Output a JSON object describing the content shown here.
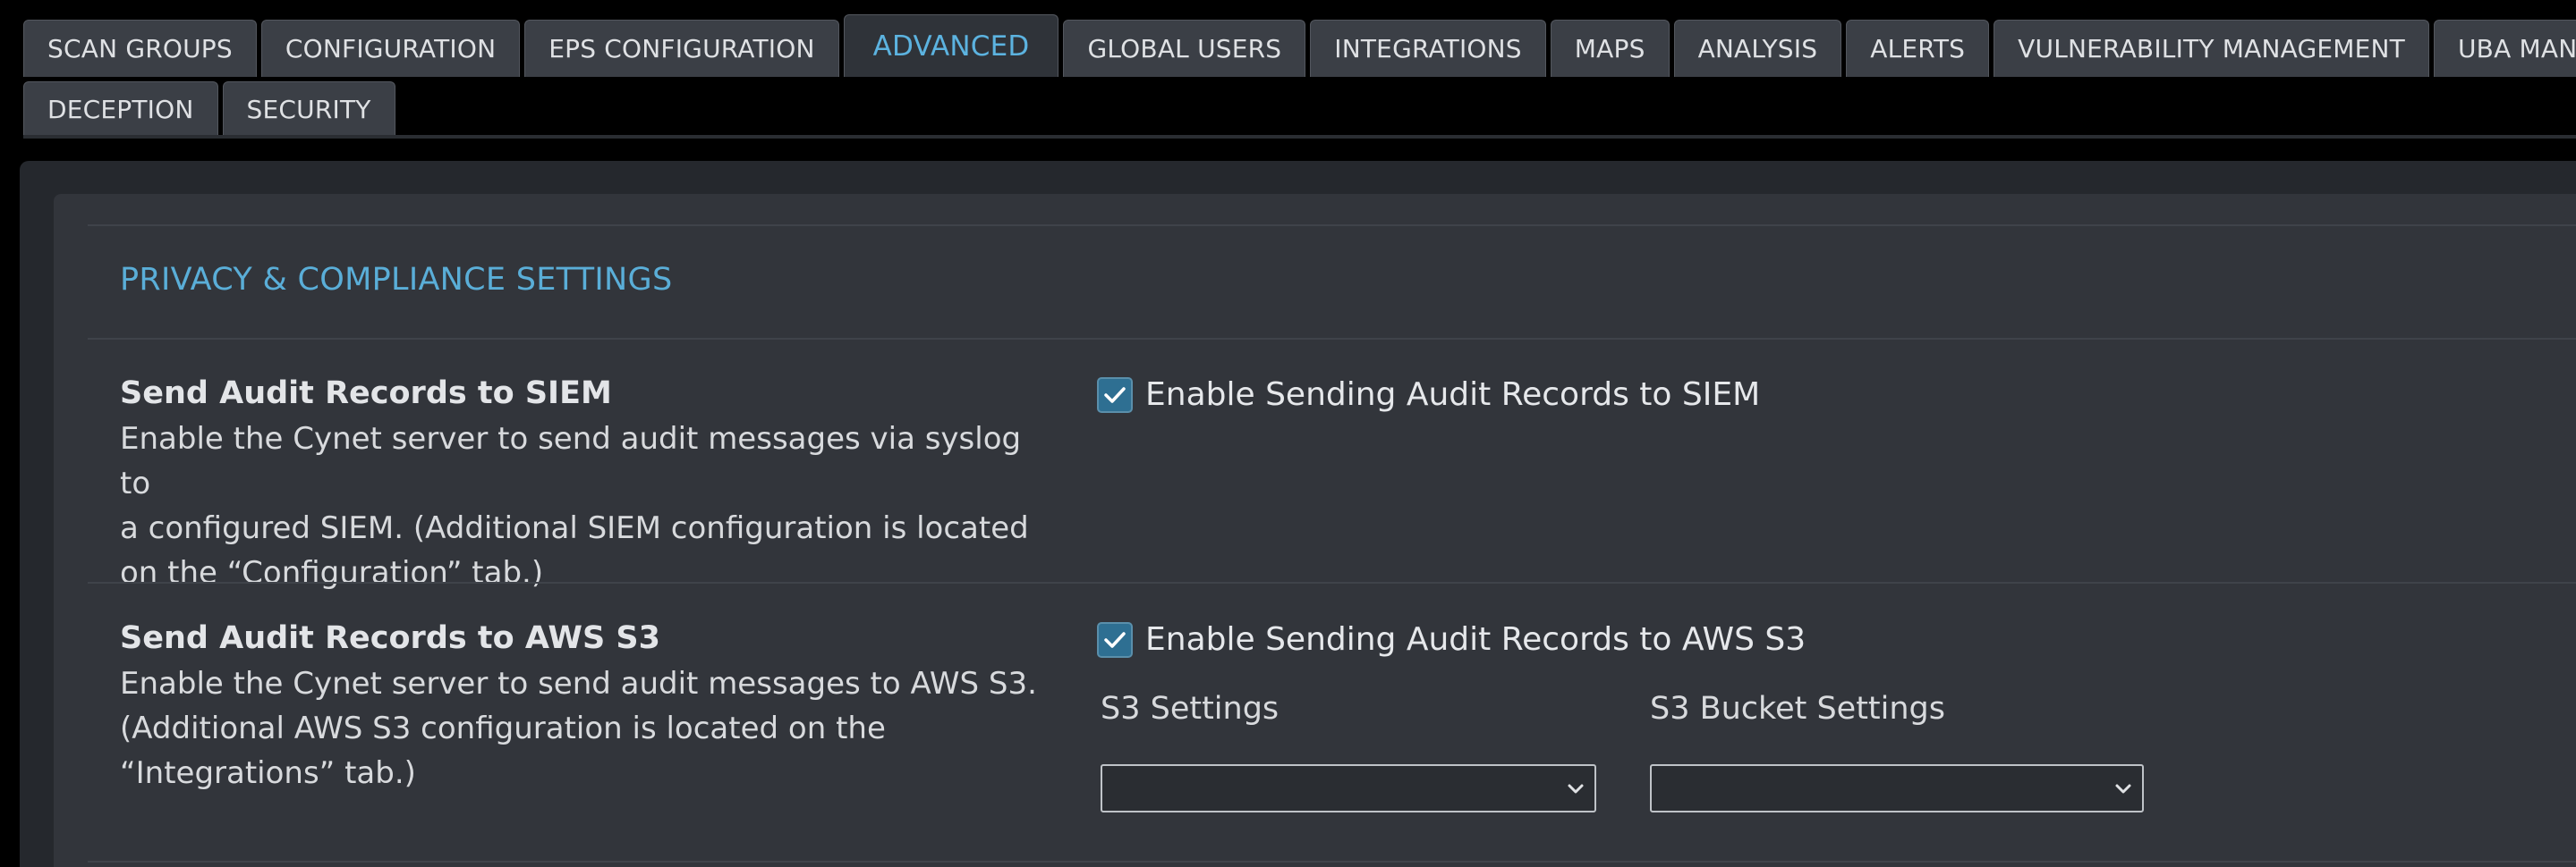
{
  "tabs_row1": [
    "SCAN GROUPS",
    "CONFIGURATION",
    "EPS CONFIGURATION",
    "ADVANCED",
    "GLOBAL USERS",
    "INTEGRATIONS",
    "MAPS",
    "ANALYSIS",
    "ALERTS",
    "VULNERABILITY MANAGEMENT",
    "UBA MANAGEMEN"
  ],
  "tabs_row2": [
    "DECEPTION",
    "SECURITY"
  ],
  "active_tab": "ADVANCED",
  "section": {
    "title": "PRIVACY & COMPLIANCE SETTINGS"
  },
  "siem": {
    "title": "Send Audit Records to SIEM",
    "description_lines": [
      "Enable the Cynet server to send audit messages via syslog to",
      "a configured SIEM. (Additional SIEM configuration is located",
      "on the “Configuration” tab.)"
    ],
    "checkbox_label": "Enable Sending Audit Records to SIEM",
    "checked": true
  },
  "s3": {
    "title": "Send Audit Records to AWS S3",
    "description_lines": [
      "Enable the Cynet server to send audit messages to AWS S3.",
      "(Additional AWS S3 configuration is located on the",
      "“Integrations” tab.)"
    ],
    "checkbox_label": "Enable Sending Audit Records to AWS S3",
    "checked": true,
    "settings_label": "S3 Settings",
    "settings_value": "",
    "bucket_label": "S3 Bucket Settings",
    "bucket_value": ""
  },
  "colors": {
    "accent": "#5cb3e0",
    "checkbox_fill": "#2e6f92",
    "panel": "#32353b",
    "background": "#000000"
  }
}
